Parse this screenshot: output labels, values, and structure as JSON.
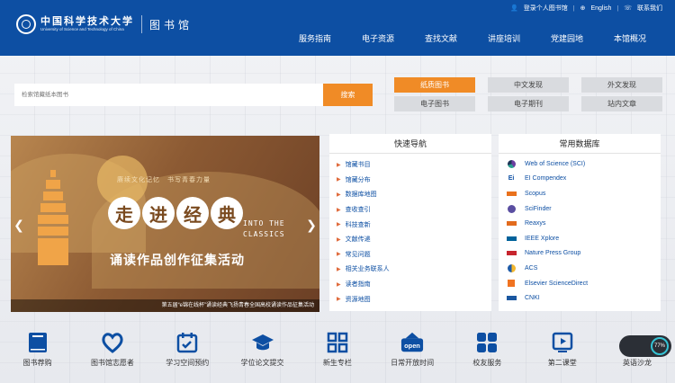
{
  "header": {
    "logo_cn": "中国科学技术大学",
    "logo_en": "University of Science and Technology of China",
    "library": "图书馆",
    "top_links": [
      "登录个人图书馆",
      "English",
      "联系我们"
    ],
    "nav": [
      "服务指南",
      "电子资源",
      "查找文献",
      "讲座培训",
      "党建园地",
      "本馆概况"
    ]
  },
  "search": {
    "placeholder": "检索馆藏纸本图书",
    "button": "搜索",
    "tabs": [
      "纸质图书",
      "中文发现",
      "外文发现",
      "电子图书",
      "电子期刊",
      "站内文章"
    ]
  },
  "carousel": {
    "slogan": "赓续文化记忆　书写青春力量",
    "title_chars": [
      "走",
      "进",
      "经",
      "典"
    ],
    "title_en": "INTO THE CLASSICS",
    "subtitle": "诵读作品创作征集活动",
    "caption": "第五届“e锦在线杯”诵读经典飞扬青春全国高校诵读作品征集活动"
  },
  "quick_nav": {
    "title": "快速导航",
    "items": [
      "馆藏书目",
      "馆藏分布",
      "数据库地图",
      "查收查引",
      "科技查新",
      "文献传递",
      "常见问题",
      "相关业务联系人",
      "读者指南",
      "资源地图"
    ]
  },
  "databases": {
    "title": "常用数据库",
    "items": [
      "Web of Science (SCI)",
      "EI Compendex",
      "Scopus",
      "SciFinder",
      "Reaxys",
      "IEEE Xplore",
      "Nature Press Group",
      "ACS",
      "Elsevier ScienceDirect",
      "CNKI"
    ]
  },
  "services": [
    "图书荐购",
    "图书馆志愿者",
    "学习空间预约",
    "学位论文提交",
    "新生专栏",
    "日常开放时间",
    "校友服务",
    "第二课堂",
    "英语沙龙"
  ],
  "open_badge": "open",
  "widget": {
    "value": "77%"
  },
  "colors": {
    "brand": "#0d4fa3",
    "accent": "#f08b26"
  }
}
